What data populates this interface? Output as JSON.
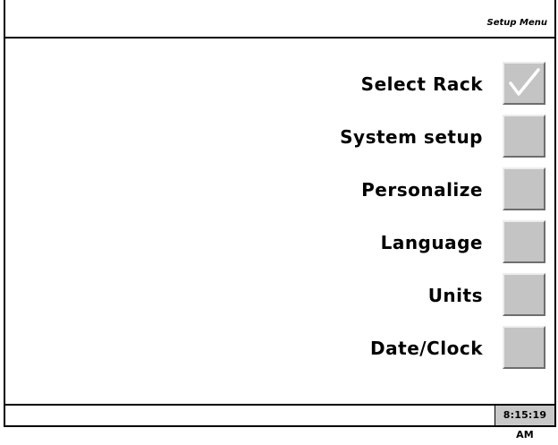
{
  "header": {
    "title": "Setup Menu"
  },
  "menu": {
    "items": [
      {
        "label": "Select Rack",
        "selected": true
      },
      {
        "label": "System setup",
        "selected": false
      },
      {
        "label": "Personalize",
        "selected": false
      },
      {
        "label": "Language",
        "selected": false
      },
      {
        "label": "Units",
        "selected": false
      },
      {
        "label": "Date/Clock",
        "selected": false
      }
    ]
  },
  "footer": {
    "clock": "8:15:19 AM"
  },
  "colors": {
    "button_face": "#c4c4c4",
    "check_mark": "#ffffff",
    "clock_background": "#c8c8c8"
  },
  "icons": {
    "selected_indicator": "check-icon"
  }
}
